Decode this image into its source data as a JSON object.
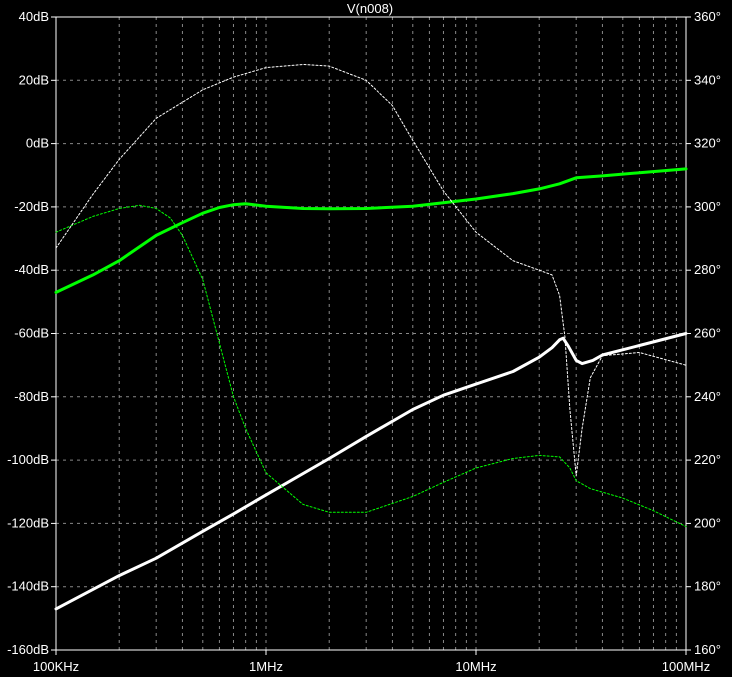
{
  "chart_data": {
    "type": "line",
    "title": "V(n008)",
    "x_scale": "log",
    "xlim": [
      100000,
      100000000
    ],
    "x_ticks": [
      {
        "value": 100000,
        "label": "100KHz"
      },
      {
        "value": 1000000,
        "label": "1MHz"
      },
      {
        "value": 10000000,
        "label": "10MHz"
      },
      {
        "value": 100000000,
        "label": "100MHz"
      }
    ],
    "ylim_left": [
      -160,
      40
    ],
    "y_ticks_left": [
      {
        "value": 40,
        "label": "40dB"
      },
      {
        "value": 20,
        "label": "20dB"
      },
      {
        "value": 0,
        "label": "0dB"
      },
      {
        "value": -20,
        "label": "-20dB"
      },
      {
        "value": -40,
        "label": "-40dB"
      },
      {
        "value": -60,
        "label": "-60dB"
      },
      {
        "value": -80,
        "label": "-80dB"
      },
      {
        "value": -100,
        "label": "-100dB"
      },
      {
        "value": -120,
        "label": "-120dB"
      },
      {
        "value": -140,
        "label": "-140dB"
      },
      {
        "value": -160,
        "label": "-160dB"
      }
    ],
    "ylim_right": [
      160,
      360
    ],
    "y_ticks_right": [
      {
        "value": 360,
        "label": "360°"
      },
      {
        "value": 340,
        "label": "340°"
      },
      {
        "value": 320,
        "label": "320°"
      },
      {
        "value": 300,
        "label": "300°"
      },
      {
        "value": 280,
        "label": "280°"
      },
      {
        "value": 260,
        "label": "260°"
      },
      {
        "value": 240,
        "label": "240°"
      },
      {
        "value": 220,
        "label": "220°"
      },
      {
        "value": 200,
        "label": "200°"
      },
      {
        "value": 180,
        "label": "180°"
      },
      {
        "value": 160,
        "label": "160°"
      }
    ],
    "grid": true,
    "colors": {
      "background": "#000000",
      "green": "#00ff00",
      "white": "#ffffff",
      "grid": "#888888"
    },
    "series": [
      {
        "color": "#00ff00",
        "style": "solid",
        "axis": "left",
        "unit": "dB",
        "points": [
          [
            100000,
            -47
          ],
          [
            150000,
            -41.5
          ],
          [
            200000,
            -37
          ],
          [
            300000,
            -29
          ],
          [
            400000,
            -25
          ],
          [
            500000,
            -22
          ],
          [
            600000,
            -20.2
          ],
          [
            700000,
            -19.3
          ],
          [
            800000,
            -19
          ],
          [
            1000000,
            -19.8
          ],
          [
            1500000,
            -20.5
          ],
          [
            2000000,
            -20.6
          ],
          [
            3000000,
            -20.5
          ],
          [
            5000000,
            -19.8
          ],
          [
            10000000,
            -17.5
          ],
          [
            15000000,
            -15.8
          ],
          [
            20000000,
            -14.3
          ],
          [
            25000000,
            -12.7
          ],
          [
            30000000,
            -10.8
          ],
          [
            40000000,
            -10.2
          ],
          [
            60000000,
            -9.2
          ],
          [
            100000000,
            -8
          ]
        ]
      },
      {
        "color": "#ffffff",
        "style": "solid",
        "axis": "left",
        "unit": "dB",
        "points": [
          [
            100000,
            -147
          ],
          [
            200000,
            -136.5
          ],
          [
            300000,
            -131
          ],
          [
            500000,
            -122.5
          ],
          [
            700000,
            -117
          ],
          [
            1000000,
            -111
          ],
          [
            2000000,
            -99.5
          ],
          [
            3000000,
            -92.5
          ],
          [
            5000000,
            -84
          ],
          [
            7000000,
            -79.5
          ],
          [
            10000000,
            -76
          ],
          [
            15000000,
            -72
          ],
          [
            20000000,
            -67.5
          ],
          [
            23000000,
            -64.5
          ],
          [
            25000000,
            -62
          ],
          [
            26000000,
            -61.5
          ],
          [
            27500000,
            -64
          ],
          [
            30000000,
            -68.5
          ],
          [
            32000000,
            -69.5
          ],
          [
            36000000,
            -68.5
          ],
          [
            40000000,
            -66.8
          ],
          [
            60000000,
            -63.8
          ],
          [
            100000000,
            -60
          ]
        ]
      },
      {
        "color": "#00ff00",
        "style": "dotted",
        "axis": "right",
        "unit": "°",
        "points": [
          [
            100000,
            292
          ],
          [
            150000,
            297
          ],
          [
            200000,
            299.5
          ],
          [
            250000,
            300.5
          ],
          [
            300000,
            299.5
          ],
          [
            350000,
            296.5
          ],
          [
            400000,
            291
          ],
          [
            500000,
            277
          ],
          [
            600000,
            257
          ],
          [
            700000,
            240
          ],
          [
            800000,
            230
          ],
          [
            1000000,
            216
          ],
          [
            1500000,
            206
          ],
          [
            2000000,
            203.5
          ],
          [
            3000000,
            203.5
          ],
          [
            5000000,
            208.5
          ],
          [
            7000000,
            213
          ],
          [
            10000000,
            217.5
          ],
          [
            15000000,
            220.5
          ],
          [
            20000000,
            221.5
          ],
          [
            25000000,
            221
          ],
          [
            28000000,
            217.5
          ],
          [
            30000000,
            213.5
          ],
          [
            35000000,
            211
          ],
          [
            50000000,
            208
          ],
          [
            70000000,
            204
          ],
          [
            100000000,
            199
          ]
        ]
      },
      {
        "color": "#ffffff",
        "style": "dotted",
        "axis": "right",
        "unit": "°",
        "points": [
          [
            100000,
            287
          ],
          [
            150000,
            304
          ],
          [
            200000,
            315
          ],
          [
            300000,
            328
          ],
          [
            500000,
            337
          ],
          [
            700000,
            341
          ],
          [
            1000000,
            344
          ],
          [
            1500000,
            345
          ],
          [
            2000000,
            344.5
          ],
          [
            3000000,
            340
          ],
          [
            4000000,
            332
          ],
          [
            5000000,
            321
          ],
          [
            7000000,
            305
          ],
          [
            10000000,
            292
          ],
          [
            15000000,
            283
          ],
          [
            20000000,
            280
          ],
          [
            23000000,
            278.5
          ],
          [
            25000000,
            272
          ],
          [
            26500000,
            259
          ],
          [
            28000000,
            236
          ],
          [
            30000000,
            215
          ],
          [
            32000000,
            230
          ],
          [
            35000000,
            246
          ],
          [
            40000000,
            253
          ],
          [
            60000000,
            254
          ],
          [
            100000000,
            250
          ]
        ]
      }
    ]
  }
}
